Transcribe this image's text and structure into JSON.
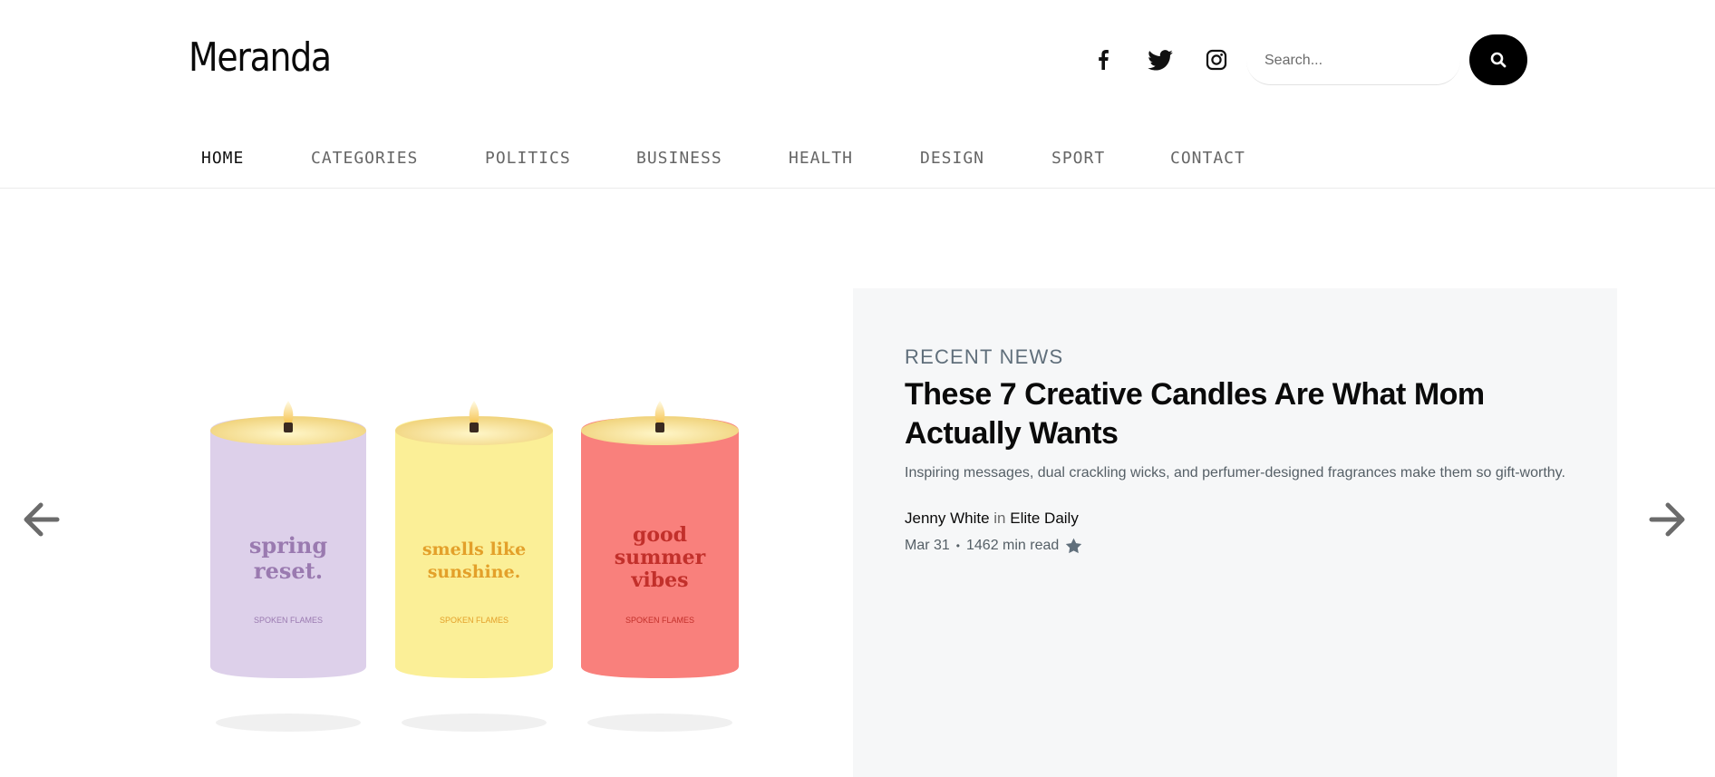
{
  "site": {
    "logo": "Meranda"
  },
  "header": {
    "social": [
      {
        "name": "facebook-icon"
      },
      {
        "name": "twitter-icon"
      },
      {
        "name": "instagram-icon"
      }
    ],
    "search": {
      "placeholder": "Search...",
      "value": "",
      "button_icon": "search-icon"
    }
  },
  "nav": {
    "items": [
      {
        "label": "HOME",
        "active": true
      },
      {
        "label": "CATEGORIES",
        "active": false
      },
      {
        "label": "POLITICS",
        "active": false
      },
      {
        "label": "BUSINESS",
        "active": false
      },
      {
        "label": "HEALTH",
        "active": false
      },
      {
        "label": "DESIGN",
        "active": false
      },
      {
        "label": "SPORT",
        "active": false
      },
      {
        "label": "CONTACT",
        "active": false
      }
    ]
  },
  "hero": {
    "candles": [
      {
        "text_lines": [
          "spring",
          "reset."
        ],
        "color": "#ddd0ea",
        "text_color": "#9a7ab0",
        "brand": "SPOKEN FLAMES"
      },
      {
        "text_lines": [
          "smells like",
          "sunshine."
        ],
        "color": "#fbef97",
        "text_color": "#e3a02a",
        "brand": "SPOKEN FLAMES"
      },
      {
        "text_lines": [
          "good",
          "summer",
          "vibes"
        ],
        "color": "#f9807c",
        "text_color": "#c2302b",
        "brand": "SPOKEN FLAMES"
      }
    ]
  },
  "featured": {
    "kicker": "RECENT NEWS",
    "title": "These 7 Creative Candles Are What Mom Actually Wants",
    "excerpt": "Inspiring messages, dual crackling wicks, and perfumer-designed fragrances make them so gift-worthy.",
    "author": "Jenny White",
    "in_word": "in",
    "publication": "Elite Daily",
    "date": "Mar 31",
    "separator": "•",
    "read_time": "1462 min read",
    "icon": "star-icon"
  },
  "slider": {
    "prev_icon": "arrow-left-icon",
    "next_icon": "arrow-right-icon"
  },
  "colors": {
    "accent": "#000000",
    "card_bg": "#f6f7f8",
    "muted": "#606f7b"
  }
}
